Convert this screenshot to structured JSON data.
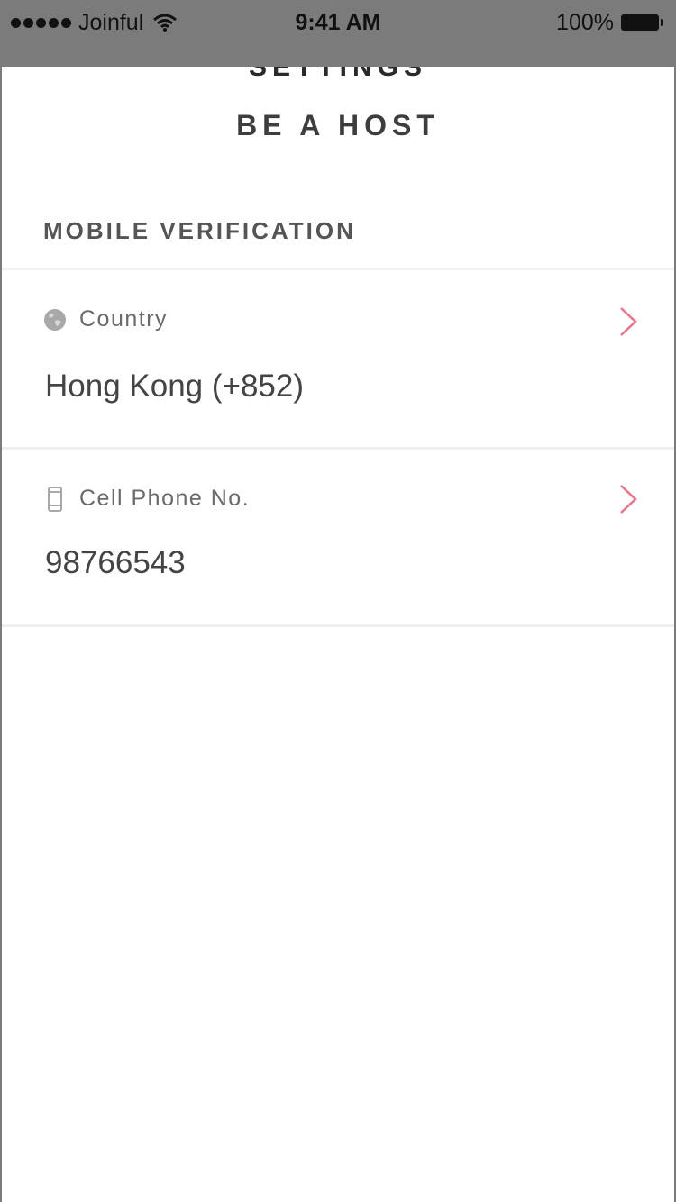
{
  "status_bar": {
    "carrier": "Joinful",
    "time": "9:41 AM",
    "battery": "100%"
  },
  "header": {
    "behind_title": "SETTINGS",
    "title": "BE A HOST"
  },
  "section": {
    "title": "MOBILE VERIFICATION"
  },
  "rows": [
    {
      "label": "Country",
      "value": "Hong Kong (+852)",
      "icon": "globe-icon"
    },
    {
      "label": "Cell Phone No.",
      "value": "98766543",
      "icon": "phone-icon"
    }
  ],
  "colors": {
    "accent": "#f0728a",
    "text": "#444444",
    "divider": "#efefef"
  }
}
